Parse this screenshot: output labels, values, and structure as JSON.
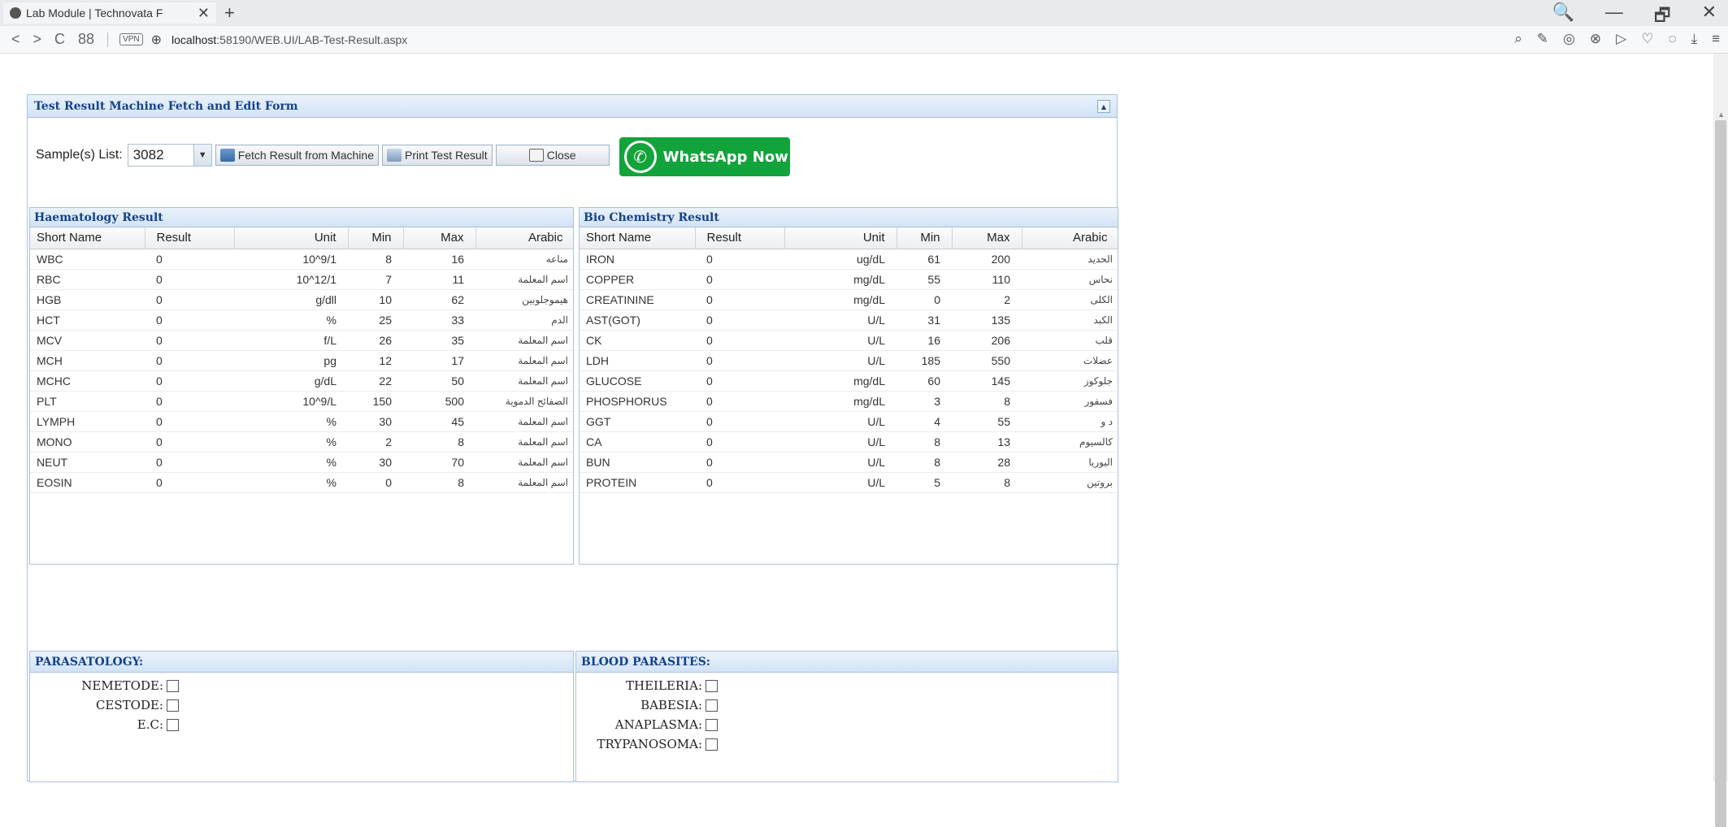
{
  "browser": {
    "tab_title": "Lab Module | Technovata F",
    "new_tab": "+",
    "close_tab": "✕",
    "url_host": "localhost",
    "url_rest": ":58190/WEB.UI/LAB-Test-Result.aspx",
    "vpn": "VPN",
    "window_controls": [
      "🔍",
      "—",
      "🗗",
      "✕"
    ]
  },
  "form": {
    "title": "Test Result Machine Fetch and Edit Form",
    "sample_label": "Sample(s) List:",
    "sample_value": "3082",
    "fetch_label": "Fetch Result from Machine",
    "print_label": "Print Test Result",
    "close_label": "Close",
    "whatsapp_label": "WhatsApp Now"
  },
  "haematology": {
    "title": "Haematology Result",
    "columns": [
      "Short Name",
      "Result",
      "Unit",
      "Min",
      "Max",
      "Arabic"
    ],
    "rows": [
      [
        "WBC",
        "0",
        "10^9/1",
        "8",
        "16",
        "مناعه"
      ],
      [
        "RBC",
        "0",
        "10^12/1",
        "7",
        "11",
        "اسم المعلمة"
      ],
      [
        "HGB",
        "0",
        "g/dll",
        "10",
        "62",
        "هيموجلوبين"
      ],
      [
        "HCT",
        "0",
        "%",
        "25",
        "33",
        "الدم"
      ],
      [
        "MCV",
        "0",
        "f/L",
        "26",
        "35",
        "اسم المعلمة"
      ],
      [
        "MCH",
        "0",
        "pg",
        "12",
        "17",
        "اسم المعلمة"
      ],
      [
        "MCHC",
        "0",
        "g/dL",
        "22",
        "50",
        "اسم المعلمة"
      ],
      [
        "PLT",
        "0",
        "10^9/L",
        "150",
        "500",
        "الصفائح الدموية"
      ],
      [
        "LYMPH",
        "0",
        "%",
        "30",
        "45",
        "اسم المعلمة"
      ],
      [
        "MONO",
        "0",
        "%",
        "2",
        "8",
        "اسم المعلمة"
      ],
      [
        "NEUT",
        "0",
        "%",
        "30",
        "70",
        "اسم المعلمة"
      ],
      [
        "EOSIN",
        "0",
        "%",
        "0",
        "8",
        "اسم المعلمة"
      ]
    ]
  },
  "biochemistry": {
    "title": "Bio Chemistry Result",
    "columns": [
      "Short Name",
      "Result",
      "Unit",
      "Min",
      "Max",
      "Arabic"
    ],
    "rows": [
      [
        "IRON",
        "0",
        "ug/dL",
        "61",
        "200",
        "الحديد"
      ],
      [
        "COPPER",
        "0",
        "mg/dL",
        "55",
        "110",
        "نحاس"
      ],
      [
        "CREATININE",
        "0",
        "mg/dL",
        "0",
        "2",
        "الكلى"
      ],
      [
        "AST(GOT)",
        "0",
        "U/L",
        "31",
        "135",
        "الكبد"
      ],
      [
        "CK",
        "0",
        "U/L",
        "16",
        "206",
        "قلب"
      ],
      [
        "LDH",
        "0",
        "U/L",
        "185",
        "550",
        "عضلات"
      ],
      [
        "GLUCOSE",
        "0",
        "mg/dL",
        "60",
        "145",
        "جلوكوز"
      ],
      [
        "PHOSPHORUS",
        "0",
        "mg/dL",
        "3",
        "8",
        "فسفور"
      ],
      [
        "GGT",
        "0",
        "U/L",
        "4",
        "55",
        "د و"
      ],
      [
        "CA",
        "0",
        "U/L",
        "8",
        "13",
        "كالسيوم"
      ],
      [
        "BUN",
        "0",
        "U/L",
        "8",
        "28",
        "اليوريا"
      ],
      [
        "PROTEIN",
        "0",
        "U/L",
        "5",
        "8",
        "بروتين"
      ]
    ]
  },
  "parasatology": {
    "title": "PARASATOLOGY:",
    "items": [
      "NEMETODE:",
      "CESTODE:",
      "E.C:"
    ]
  },
  "blood_parasites": {
    "title": "BLOOD PARASITES:",
    "items": [
      "THEILERIA:",
      "BABESIA:",
      "ANAPLASMA:",
      "TRYPANOSOMA:"
    ]
  }
}
